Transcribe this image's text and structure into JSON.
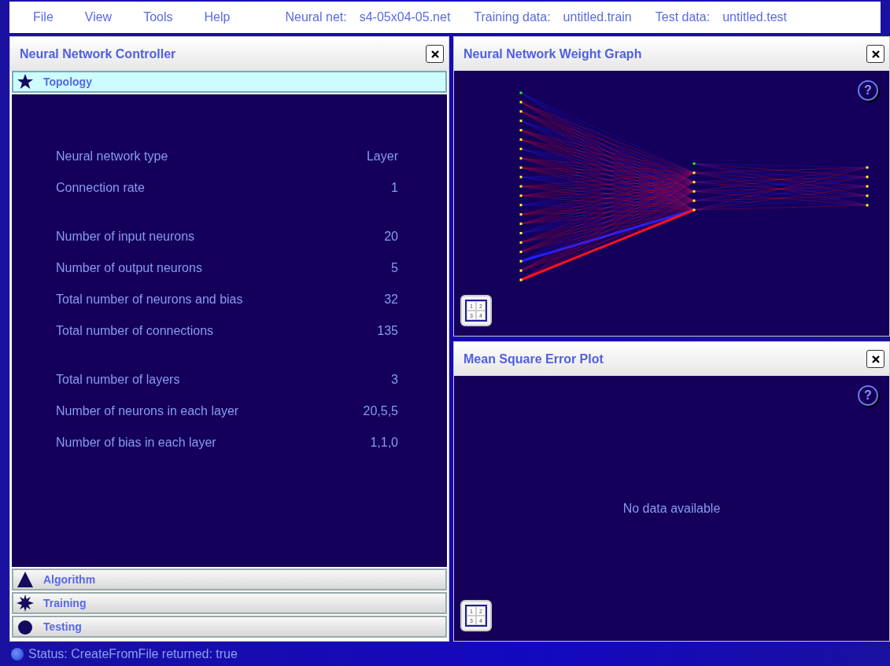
{
  "menu": [
    "File",
    "View",
    "Tools",
    "Help"
  ],
  "file_info": [
    {
      "label": "Neural net:",
      "value": "s4-05x04-05.net"
    },
    {
      "label": "Training data:",
      "value": "untitled.train"
    },
    {
      "label": "Test data:",
      "value": "untitled.test"
    }
  ],
  "controller": {
    "title": "Neural Network Controller",
    "sections": [
      {
        "label": "Topology",
        "selected": true
      },
      {
        "label": "Algorithm",
        "selected": false
      },
      {
        "label": "Training",
        "selected": false
      },
      {
        "label": "Testing",
        "selected": false
      }
    ],
    "topology_groups": [
      [
        {
          "label": "Neural network type",
          "value": "Layer"
        },
        {
          "label": "Connection rate",
          "value": "1"
        }
      ],
      [
        {
          "label": "Number of input neurons",
          "value": "20"
        },
        {
          "label": "Number of output neurons",
          "value": "5"
        },
        {
          "label": "Total number of neurons and bias",
          "value": "32"
        },
        {
          "label": "Total number of connections",
          "value": "135"
        }
      ],
      [
        {
          "label": "Total number of layers",
          "value": "3"
        },
        {
          "label": "Number of neurons in each layer",
          "value": "20,5,5"
        },
        {
          "label": "Number of bias in each layer",
          "value": "1,1,0"
        }
      ]
    ]
  },
  "weight_graph": {
    "title": "Neural Network Weight Graph",
    "help": "?",
    "layout_keys": [
      "1",
      "2",
      "3",
      "4"
    ]
  },
  "mse_plot": {
    "title": "Mean Square Error Plot",
    "help": "?",
    "message": "No data available",
    "layout_keys": [
      "1",
      "2",
      "3",
      "4"
    ]
  },
  "status_bar": "Status: CreateFromFile returned: true"
}
